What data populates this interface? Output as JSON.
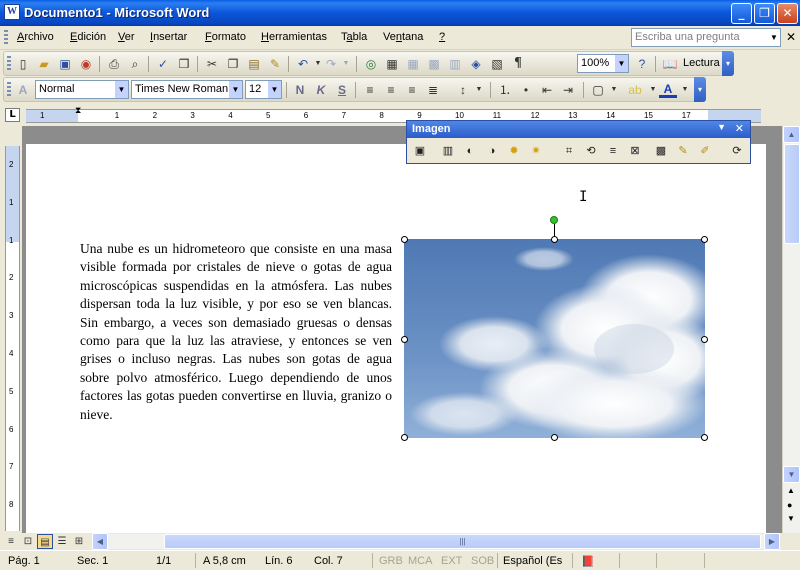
{
  "window": {
    "title": "Documento1 - Microsoft Word",
    "app_icon": "W",
    "minimize": "_",
    "maximize": "❐",
    "close": "✕"
  },
  "menu": {
    "items": [
      {
        "pre": "",
        "u": "A",
        "post": "rchivo"
      },
      {
        "pre": "",
        "u": "E",
        "post": "dición"
      },
      {
        "pre": "",
        "u": "V",
        "post": "er"
      },
      {
        "pre": "",
        "u": "I",
        "post": "nsertar"
      },
      {
        "pre": "",
        "u": "F",
        "post": "ormato"
      },
      {
        "pre": "",
        "u": "H",
        "post": "erramientas"
      },
      {
        "pre": "T",
        "u": "a",
        "post": "bla"
      },
      {
        "pre": "Ve",
        "u": "n",
        "post": "tana"
      },
      {
        "pre": "",
        "u": "?",
        "post": ""
      }
    ],
    "ask_placeholder": "Escriba una pregunta",
    "doc_close": "✕"
  },
  "standard_toolbar": {
    "zoom": "100%",
    "lectura_label": "Lectura",
    "pilcrow": "¶",
    "icons": [
      "new-document-icon",
      "open-icon",
      "save-icon",
      "permission-icon",
      "print-icon",
      "print-preview-icon",
      "spelling-icon",
      "research-icon",
      "cut-icon",
      "copy-icon",
      "paste-icon",
      "format-painter-icon",
      "undo-icon",
      "redo-icon",
      "hyperlink-icon",
      "tables-borders-icon",
      "insert-table-icon",
      "insert-excel-icon",
      "columns-icon",
      "drawing-icon",
      "document-map-icon",
      "show-hide-icon",
      "help-icon",
      "reading-layout-icon"
    ]
  },
  "format_toolbar": {
    "style": "Normal",
    "font": "Times New Roman",
    "size": "12",
    "bold": "N",
    "italic": "K",
    "underline": "S",
    "font_color_letter": "A"
  },
  "ruler": {
    "tab_selector": "L",
    "h_numbers": [
      "1",
      "1",
      "2",
      "3",
      "4",
      "5",
      "6",
      "7",
      "8",
      "9",
      "10",
      "11",
      "12",
      "13",
      "14",
      "15",
      "17"
    ],
    "v_numbers": [
      "2",
      "1",
      "1",
      "2",
      "3",
      "4",
      "5",
      "6",
      "7",
      "8"
    ]
  },
  "picture_toolbar": {
    "title": "Imagen",
    "icons": [
      "insert-picture-icon",
      "color-icon",
      "more-contrast-icon",
      "less-contrast-icon",
      "more-brightness-icon",
      "less-brightness-icon",
      "crop-icon",
      "rotate-left-icon",
      "line-style-icon",
      "compress-icon",
      "text-wrapping-icon",
      "format-picture-icon",
      "set-transparent-color-icon",
      "reset-picture-icon"
    ]
  },
  "document": {
    "paragraph": "Una nube es un hidrometeoro que consiste en una masa visible formada por cristales de nieve o gotas de agua microscópicas suspendidas en la atmósfera. Las nubes dispersan toda la luz visible, y por eso se ven blancas. Sin embargo, a veces son demasiado gruesas o densas como para que la luz las atraviese, y entonces se ven grises o incluso negras. Las nubes son gotas de agua sobre polvo atmosférico. Luego dependiendo de unos factores las gotas pueden convertirse en lluvia, granizo o nieve."
  },
  "status": {
    "page": "Pág. 1",
    "section": "Sec. 1",
    "pages": "1/1",
    "at": "A 5,8 cm",
    "line": "Lín. 6",
    "col": "Col. 7",
    "grb": "GRB",
    "mca": "MCA",
    "ext": "EXT",
    "sob": "SOB",
    "language": "Español (Es"
  },
  "colors": {
    "titlebar": "#0b55d9",
    "sky": "#5a82b8",
    "toolbar_chevron": "#2f5fc2"
  }
}
